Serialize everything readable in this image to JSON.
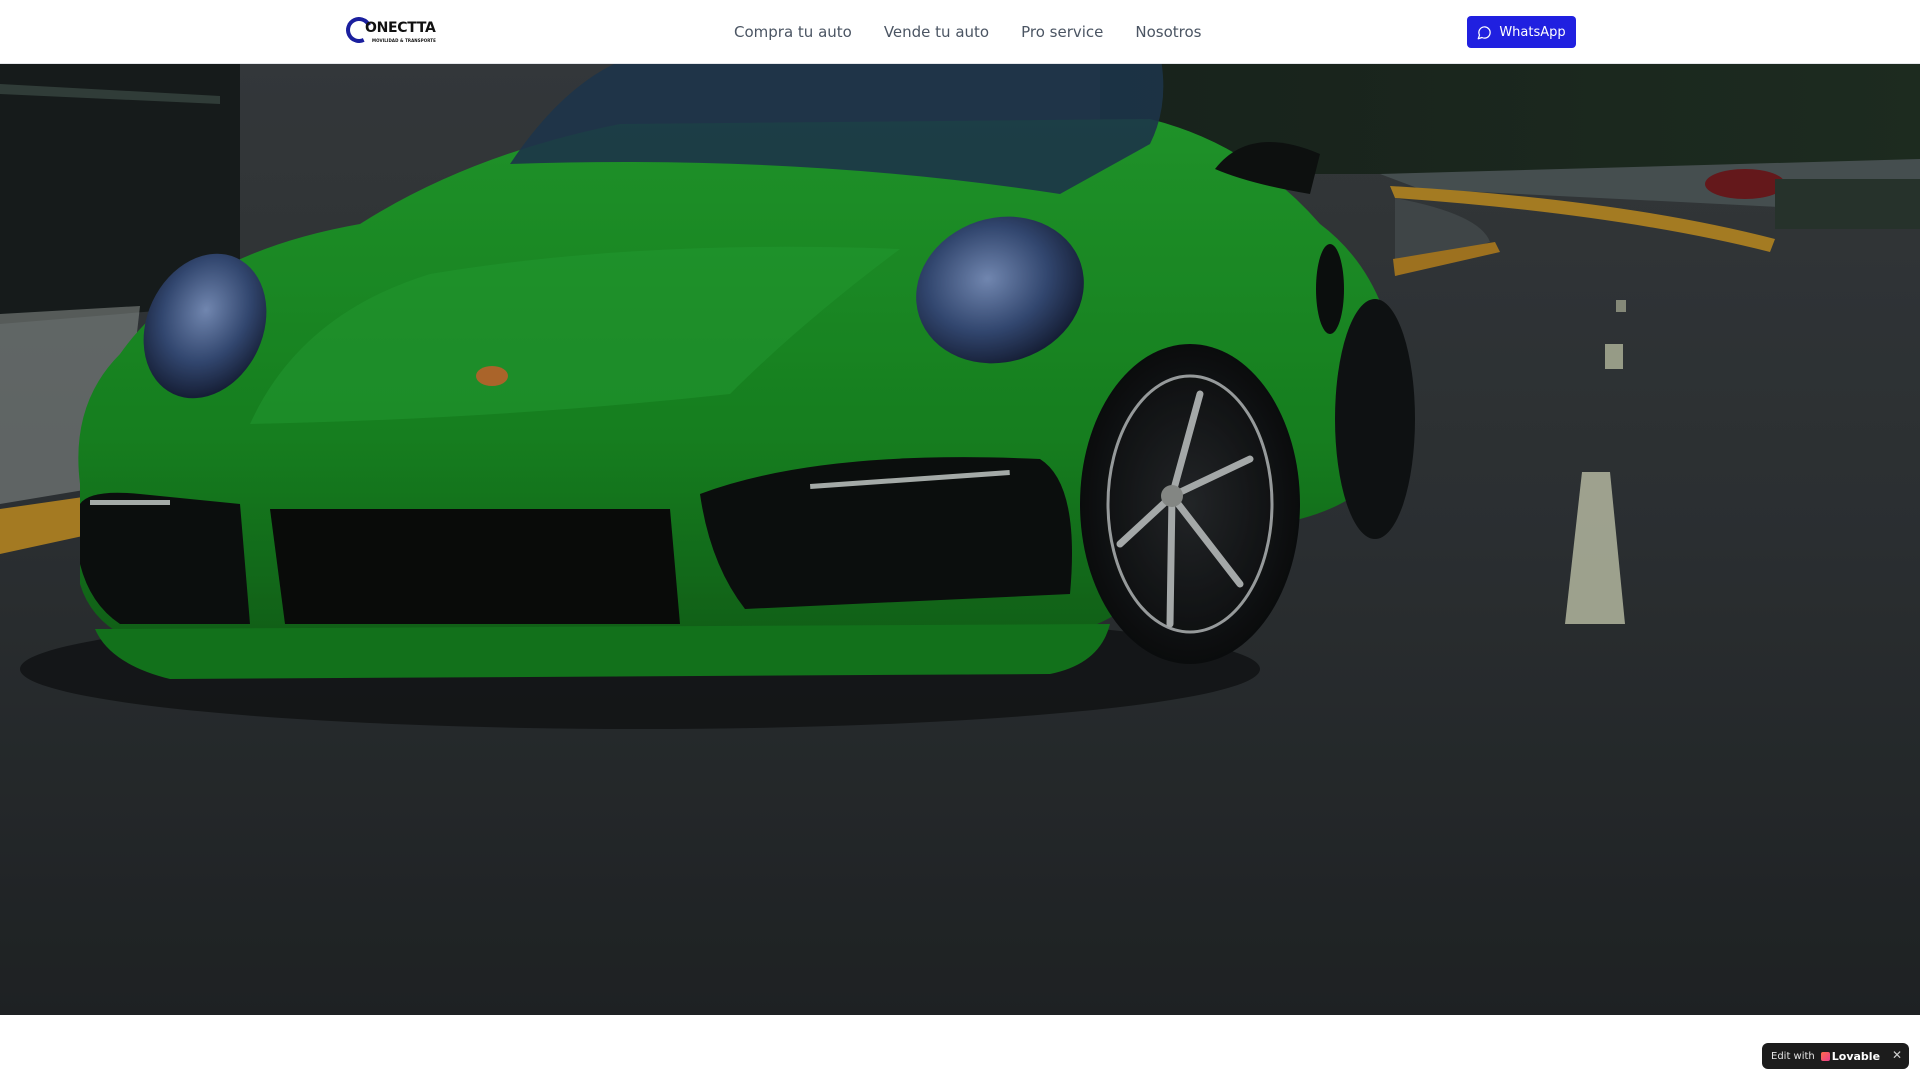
{
  "header": {
    "logo": {
      "wordmark": "ONECTTA",
      "tagline": "MOVILIDAD & TRANSPORTE"
    },
    "nav": [
      {
        "label": "Compra tu auto"
      },
      {
        "label": "Vende tu auto"
      },
      {
        "label": "Pro service"
      },
      {
        "label": "Nosotros"
      }
    ],
    "whatsapp_label": "WhatsApp",
    "accent_color": "#2020e0"
  },
  "hero": {
    "image": "green-sports-car-on-road",
    "car_color": "#1fa02a"
  },
  "badge": {
    "prefix": "Edit with",
    "brand": "Lovable",
    "close_icon": "close-icon"
  }
}
